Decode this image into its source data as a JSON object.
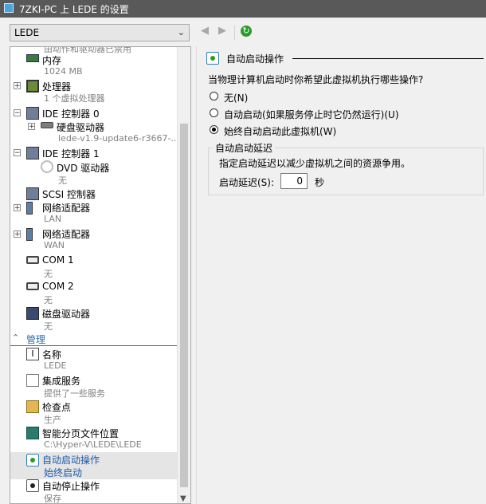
{
  "window": {
    "title": "7ZKI-PC 上 LEDE 的设置"
  },
  "toolbar": {
    "vm_selected": "LEDE",
    "back_glyph": "◀",
    "forward_glyph": "▶",
    "refresh_glyph": "↻"
  },
  "tree": {
    "cut_top": "由动作和驱动器已禁用",
    "memory": {
      "label": "内存",
      "sub": "1024 MB"
    },
    "cpu": {
      "label": "处理器",
      "sub": "1 个虚拟处理器"
    },
    "ide0": {
      "label": "IDE 控制器 0"
    },
    "hdd": {
      "label": "硬盘驱动器",
      "sub": "lede-v1.9-update6-r3667-..."
    },
    "ide1": {
      "label": "IDE 控制器 1"
    },
    "dvd": {
      "label": "DVD 驱动器",
      "sub": "无"
    },
    "scsi": {
      "label": "SCSI 控制器"
    },
    "net1": {
      "label": "网络适配器",
      "sub": "LAN"
    },
    "net2": {
      "label": "网络适配器",
      "sub": "WAN"
    },
    "com1": {
      "label": "COM 1",
      "sub": "无"
    },
    "com2": {
      "label": "COM 2",
      "sub": "无"
    },
    "floppy": {
      "label": "磁盘驱动器",
      "sub": "无"
    },
    "management": {
      "label": "管理"
    },
    "name": {
      "label": "名称",
      "sub": "LEDE"
    },
    "integration": {
      "label": "集成服务",
      "sub": "提供了一些服务"
    },
    "checkpoint": {
      "label": "检查点",
      "sub": "生产"
    },
    "smartpaging": {
      "label": "智能分页文件位置",
      "sub": "C:\\Hyper-V\\LEDE\\LEDE"
    },
    "autostart": {
      "label": "自动启动操作",
      "sub": "始终启动"
    },
    "autostop": {
      "label": "自动停止操作",
      "sub": "保存"
    },
    "expand_plus": "+",
    "expand_minus": "−"
  },
  "panel": {
    "header": "自动启动操作",
    "question": "当物理计算机启动时你希望此虚拟机执行哪些操作?",
    "options": [
      {
        "label": "无(N)",
        "checked": false
      },
      {
        "label": "自动启动(如果服务停止时它仍然运行)(U)",
        "checked": false
      },
      {
        "label": "始终自动启动此虚拟机(W)",
        "checked": true
      }
    ],
    "delay": {
      "legend": "自动启动延迟",
      "description": "指定启动延迟以减少虚拟机之间的资源争用。",
      "label": "启动延迟(S):",
      "value": "0",
      "unit": "秒"
    }
  },
  "colors": {
    "titlebar": "#595959",
    "accent": "#2b6cb0",
    "selection": "#e5e5e5"
  }
}
